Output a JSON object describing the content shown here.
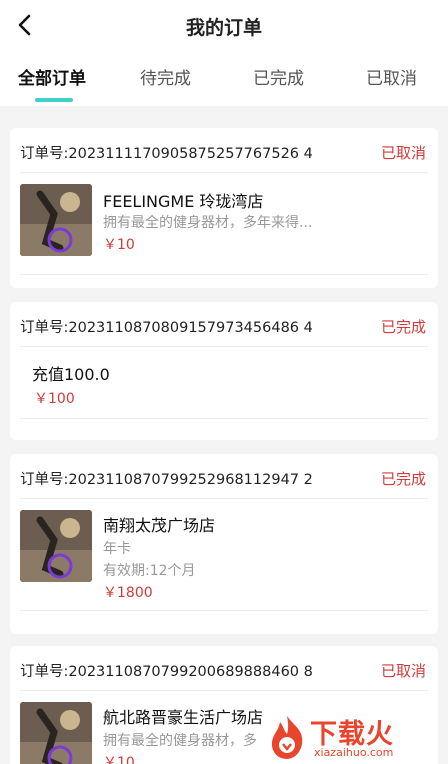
{
  "header": {
    "title": "我的订单",
    "back_icon": "chevron-left-icon"
  },
  "tabs": [
    {
      "label": "全部订单",
      "active": true
    },
    {
      "label": "待完成",
      "active": false
    },
    {
      "label": "已完成",
      "active": false
    },
    {
      "label": "已取消",
      "active": false
    }
  ],
  "colors": {
    "accent": "#3fd0c9",
    "status_red": "#d23b3b",
    "background": "#f4f4f4"
  },
  "orders": [
    {
      "order_no": "订单号:2023111170905875257767526 4",
      "status": "已取消",
      "store": "FEELINGME 玲珑湾店",
      "desc": "拥有最全的健身器材，多年来得...",
      "price": "￥10"
    },
    {
      "order_no": "订单号:2023110870809157973456486 4",
      "status": "已完成",
      "item": "充值100.0",
      "price": "￥100"
    },
    {
      "order_no": "订单号:2023110870799252968112947 2",
      "status": "已完成",
      "store": "南翔太茂广场店",
      "desc": "年卡",
      "validity": "有效期:12个月",
      "price": "￥1800"
    },
    {
      "order_no": "订单号:2023110870799200689888460 8",
      "status": "已取消",
      "store": "航北路晋豪生活广场店",
      "desc": "拥有最全的健身器材，多",
      "price": "￥10"
    }
  ],
  "watermark": {
    "text": "下载火",
    "url": "xiazaihuo.com"
  }
}
